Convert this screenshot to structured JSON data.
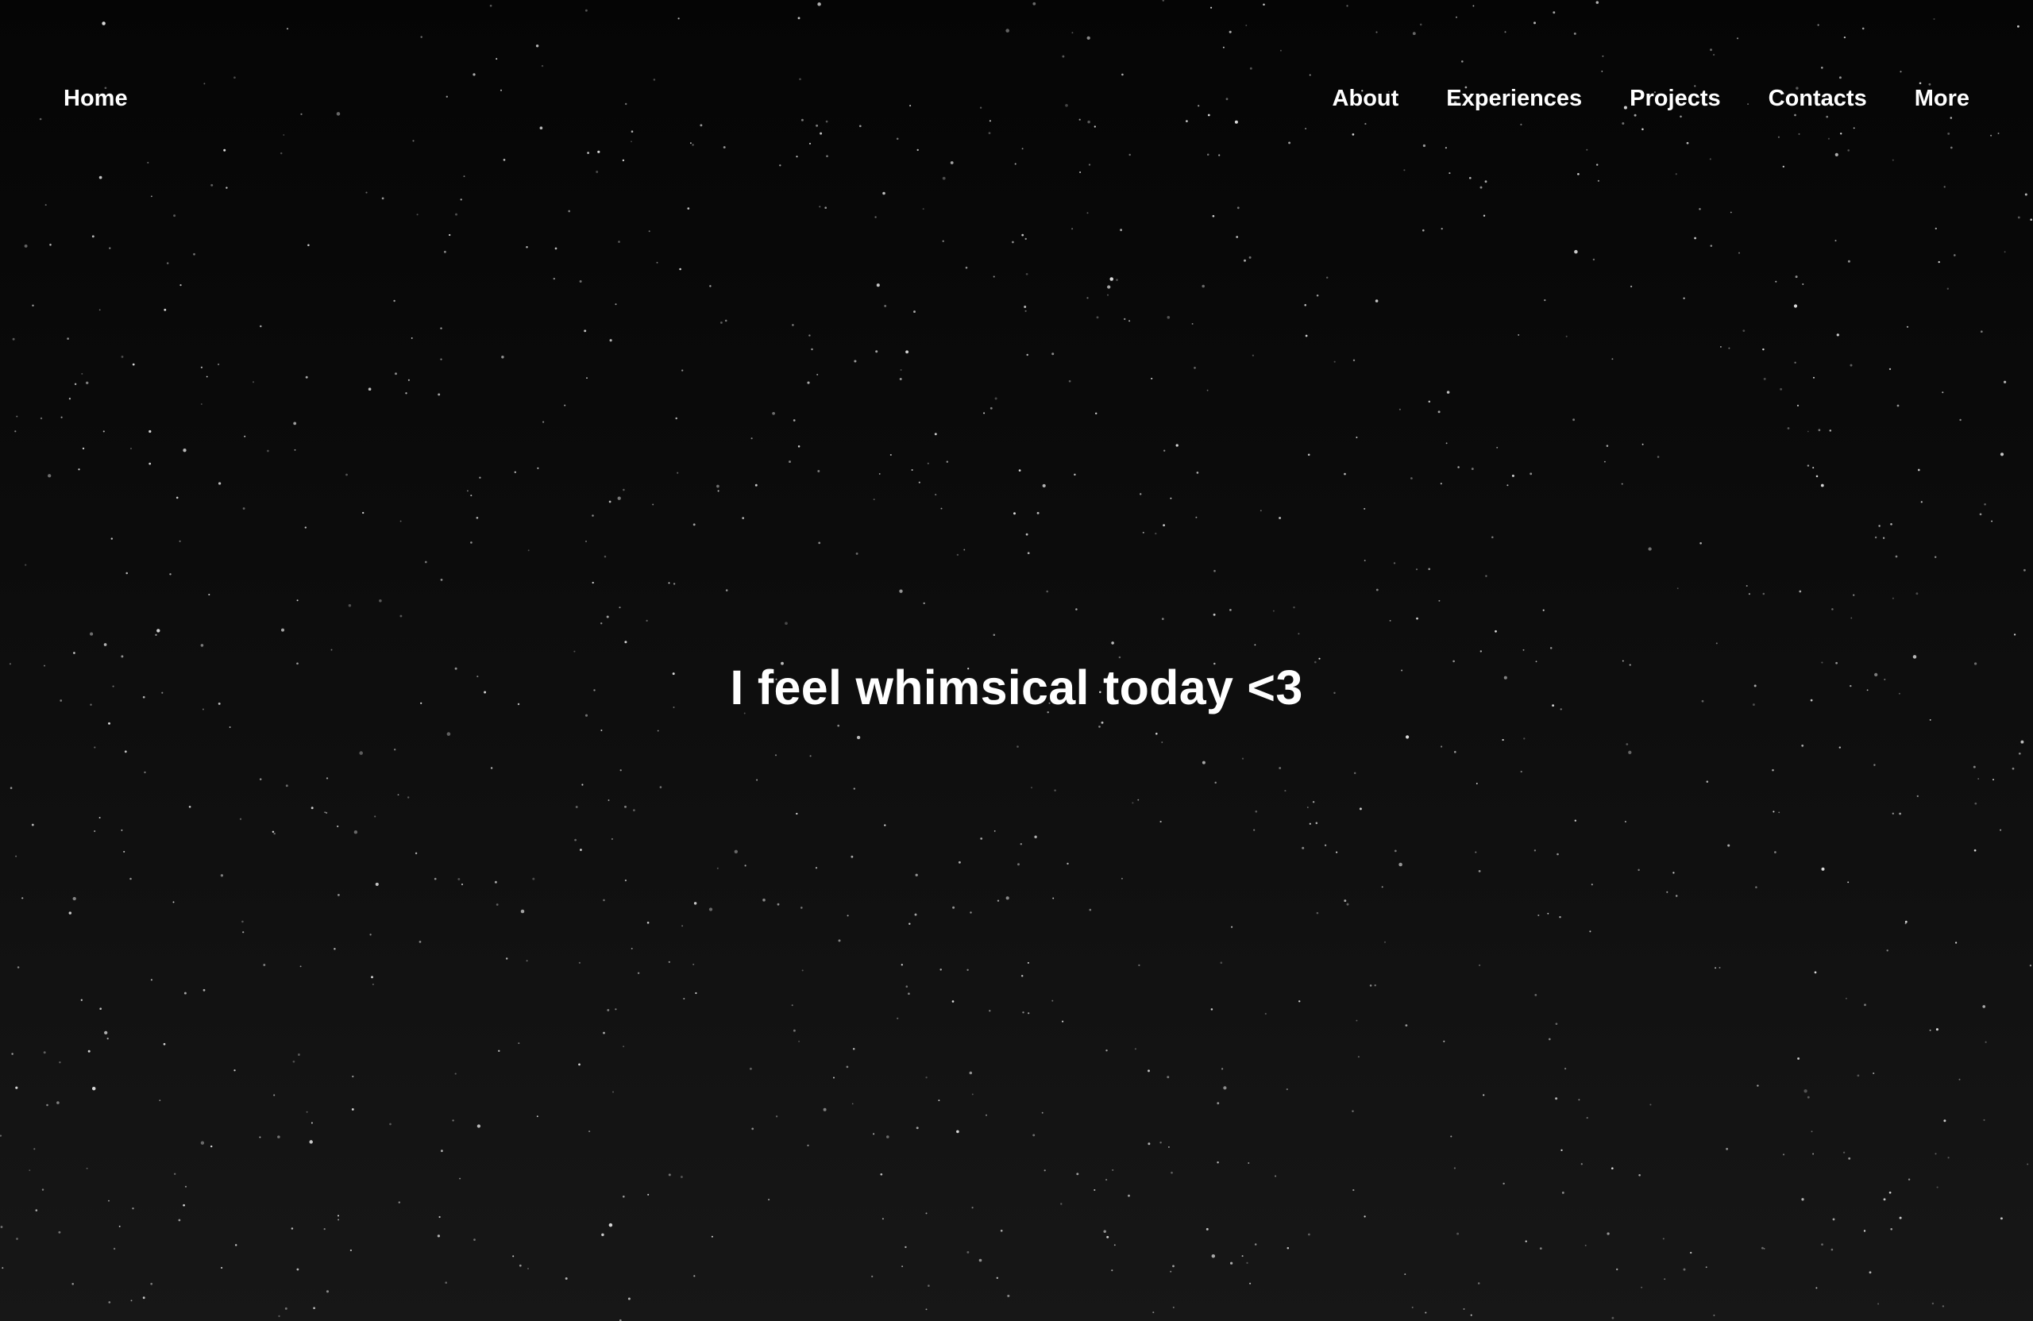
{
  "nav": {
    "home_label": "Home",
    "items": [
      {
        "label": "About"
      },
      {
        "label": "Experiences"
      },
      {
        "label": "Projects"
      },
      {
        "label": "Contacts"
      },
      {
        "label": "More"
      }
    ]
  },
  "hero": {
    "title": "I feel whimsical today <3"
  },
  "colors": {
    "background_top": "#050505",
    "background_bottom": "#171717",
    "text": "#ffffff"
  }
}
